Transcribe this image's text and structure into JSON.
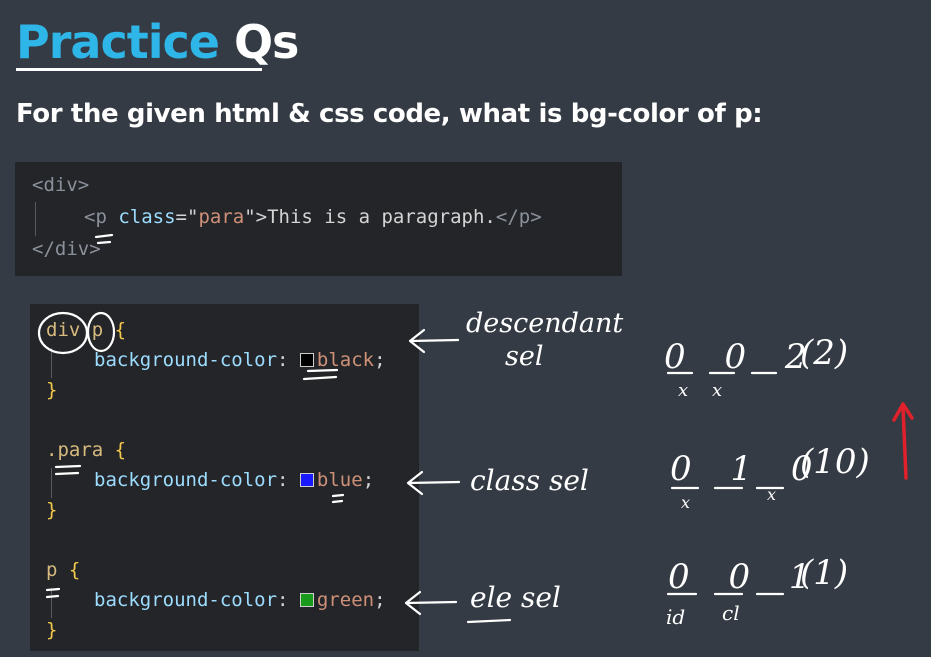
{
  "title": {
    "accent": "Practice",
    "rest": " Qs"
  },
  "question": "For the given html & css code, what is bg-color of p:",
  "html_code": {
    "line1": "<div>",
    "line2_open": "<p",
    "line2_attr": "class",
    "line2_eq": "=\"",
    "line2_val": "para",
    "line2_close_q": "\">",
    "line2_text": "This is a paragraph.",
    "line2_end": "</p>",
    "line3": "</div>"
  },
  "css_rules": [
    {
      "selector": "div p",
      "property": "background-color",
      "value": "black",
      "swatch": "#000000"
    },
    {
      "selector": ".para",
      "property": "background-color",
      "value": "blue",
      "swatch": "#1a1aff"
    },
    {
      "selector": "p",
      "property": "background-color",
      "value": "green",
      "swatch": "#1a9a1a"
    }
  ],
  "annotations": {
    "rule1_label_line1": "descendant",
    "rule1_label_line2": "sel",
    "rule2_label": "class sel",
    "rule3_label": "ele sel",
    "rule1_spec": "0 0 2",
    "rule1_total": "(2)",
    "rule2_spec": "0 1 0",
    "rule2_total": "(10)",
    "rule3_spec": "0 0 1",
    "rule3_total": "(1)",
    "col_id": "id",
    "col_cl": "cl",
    "col_x": "x"
  },
  "colors": {
    "background": "#343b44",
    "code_bg": "#242529",
    "title_accent": "#2fb6e8",
    "ink": "#ffffff",
    "arrow_red": "#e0202a"
  }
}
